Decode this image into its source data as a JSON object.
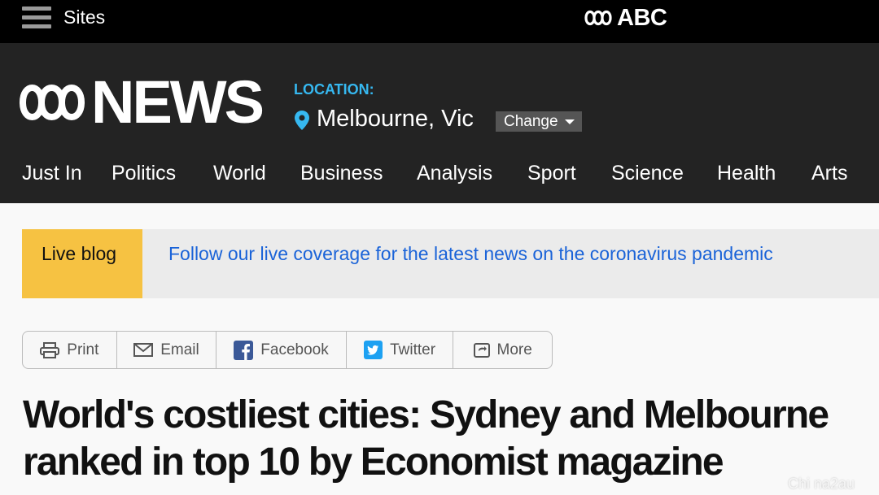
{
  "topbar": {
    "sites_label": "Sites",
    "abc_label": "ABC"
  },
  "header": {
    "news_label": "NEWS",
    "location_label": "LOCATION:",
    "location_value": "Melbourne, Vic",
    "change_label": "Change"
  },
  "nav": {
    "items": [
      "Just In",
      "Politics",
      "World",
      "Business",
      "Analysis",
      "Sport",
      "Science",
      "Health",
      "Arts"
    ]
  },
  "banner": {
    "tag": "Live blog",
    "link": "Follow our live coverage for the latest news on the coronavirus pandemic"
  },
  "share": {
    "print": "Print",
    "email": "Email",
    "facebook": "Facebook",
    "twitter": "Twitter",
    "more": "More"
  },
  "article": {
    "headline": "World's costliest cities: Sydney and Melbourne ranked in top 10 by Economist magazine"
  },
  "watermark": "Chi na2au",
  "colors": {
    "topbar_bg": "#000000",
    "header_bg": "#232323",
    "location_accent": "#36b8f0",
    "live_tag_bg": "#f6c242",
    "link_blue": "#1a63d8",
    "facebook_blue": "#3b5998",
    "twitter_blue": "#1da1f2"
  },
  "icons": {
    "menu": "hamburger-icon",
    "location": "map-pin-icon",
    "print": "printer-icon",
    "email": "envelope-icon",
    "facebook": "facebook-icon",
    "twitter": "twitter-icon",
    "more": "share-more-icon"
  }
}
